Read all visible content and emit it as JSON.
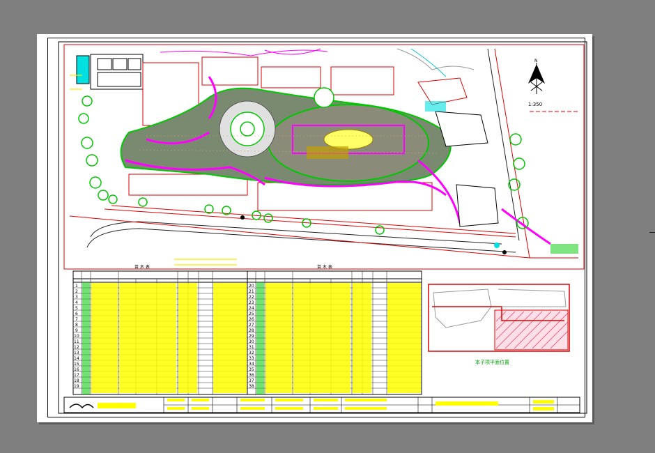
{
  "drawing": {
    "scale_label": "1:350",
    "north_symbol": "N",
    "keyplan_caption": "本子项平面位置",
    "table_title_left": "苗 木 表",
    "table_title_right": "苗 木 表"
  },
  "colors": {
    "background": "#808080",
    "paper": "#ffffff",
    "red": "#e00000",
    "green": "#00c800",
    "magenta": "#ff00ff",
    "yellow": "#ffff00",
    "cyan": "#00e0e0",
    "olive": "#a08000"
  }
}
